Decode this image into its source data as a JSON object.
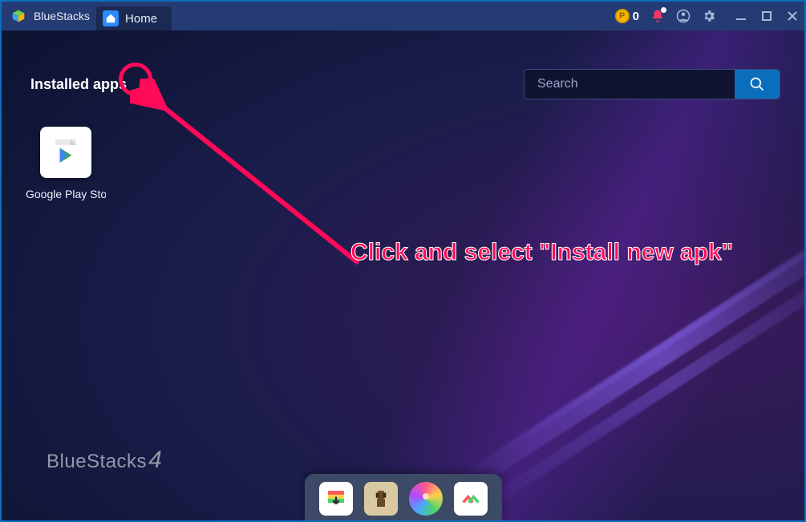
{
  "titlebar": {
    "app_name": "BlueStacks",
    "tab_label": "Home",
    "coin_count": "0"
  },
  "section": {
    "title": "Installed apps"
  },
  "search": {
    "placeholder": "Search"
  },
  "apps": [
    {
      "label": "Google Play Store"
    }
  ],
  "watermark": {
    "brand": "BlueStacks",
    "version": "4"
  },
  "annotation": {
    "text": "Click and select \"Install new apk\""
  }
}
